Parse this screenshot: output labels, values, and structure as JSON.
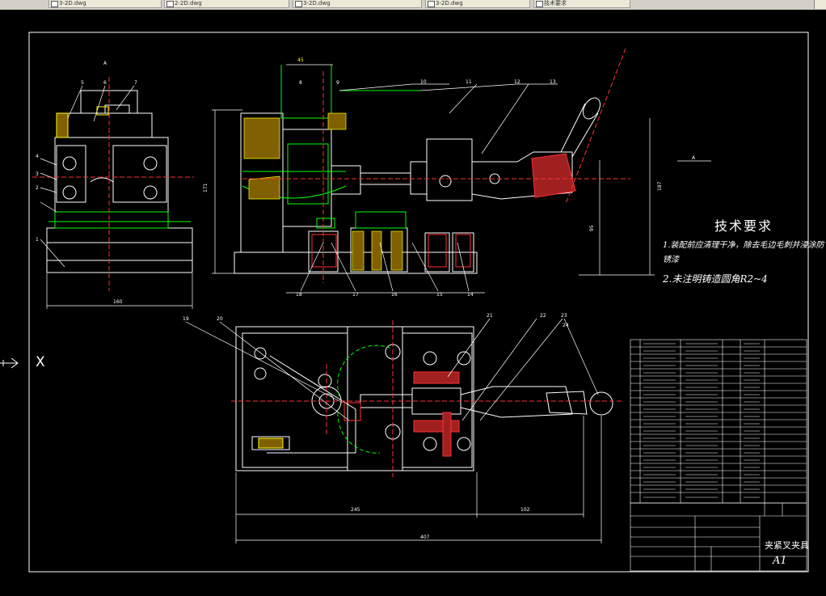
{
  "window": {
    "tabs": [
      {
        "label": "3-2D.dwg"
      },
      {
        "label": "2-2D.dwg"
      },
      {
        "label": "3-2D.dwg"
      },
      {
        "label": "3-2D.dwg"
      },
      {
        "label": "技术要求"
      }
    ]
  },
  "drawing": {
    "tech_requirements": {
      "title": "技术要求",
      "line1": "1.装配前应清理干净，除去毛边毛刺并浸涂防",
      "line2": "锈漆",
      "line3": "2.未注明铸造圆角R2~4"
    },
    "title_block": {
      "drawing_name": "夹紧叉夹具",
      "sheet_size": "A1"
    },
    "dimensions": {
      "front_height": "171",
      "side_height": "187",
      "sub_height": "95",
      "left_width": "160",
      "top_width": "45",
      "bottom_245": "245",
      "bottom_102": "102",
      "bottom_total": "407"
    },
    "part_numbers": [
      "1",
      "2",
      "3",
      "4",
      "5",
      "6",
      "7",
      "8",
      "9",
      "10",
      "11",
      "12",
      "13",
      "14",
      "15",
      "16",
      "17",
      "18",
      "19",
      "20",
      "21",
      "22",
      "23",
      "24"
    ],
    "section_label": "A",
    "ucs_label": "X",
    "colors": {
      "background": "#000000",
      "outline": "#ffffff",
      "green": "#00ff00",
      "red": "#ff3030",
      "yellow": "#ffff00",
      "hatch_red": "#c02020"
    }
  }
}
